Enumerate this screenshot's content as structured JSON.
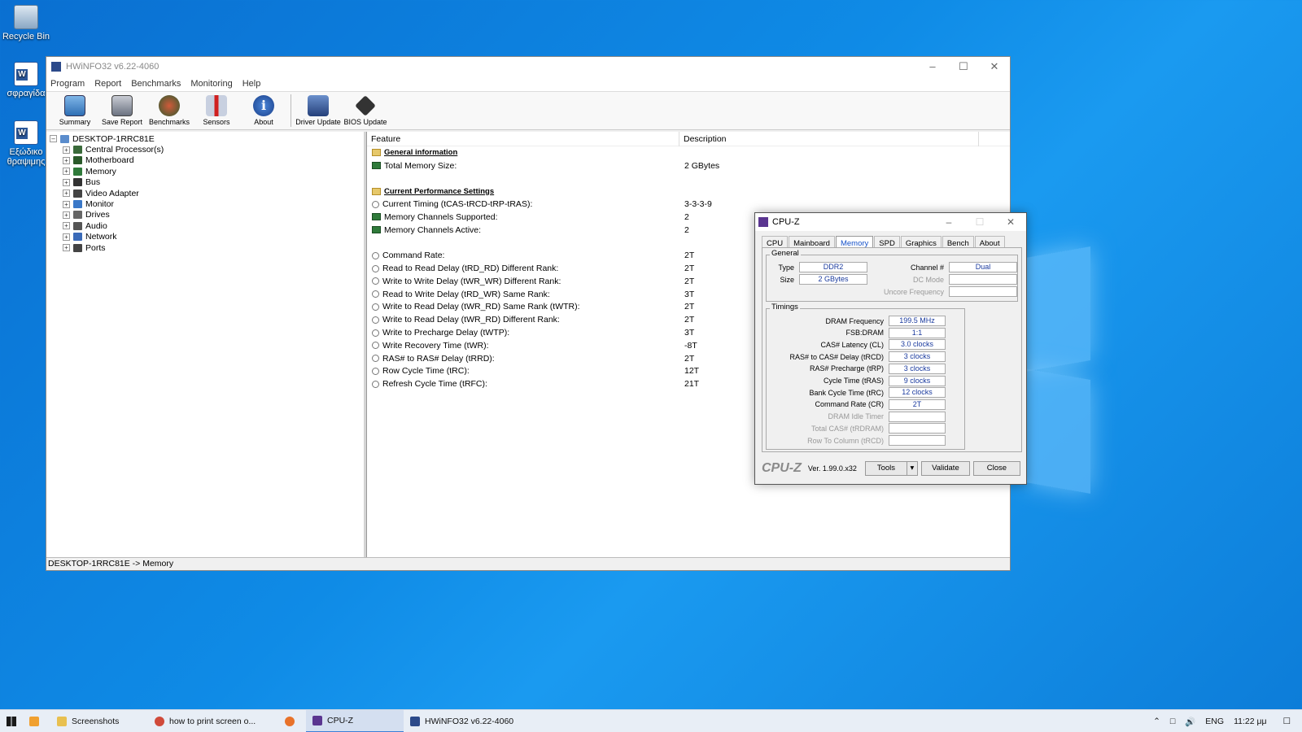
{
  "desktop": {
    "icons": [
      {
        "label": "Recycle Bin"
      },
      {
        "label": "σφραγίδα"
      },
      {
        "label": "Εξώδικο θραψιμης"
      }
    ]
  },
  "hwinfo": {
    "title": "HWiNFO32 v6.22-4060",
    "menu": [
      "Program",
      "Report",
      "Benchmarks",
      "Monitoring",
      "Help"
    ],
    "toolbar": [
      {
        "label": "Summary",
        "icon": "monitor-icon"
      },
      {
        "label": "Save Report",
        "icon": "save-icon"
      },
      {
        "label": "Benchmarks",
        "icon": "gauge-icon"
      },
      {
        "label": "Sensors",
        "icon": "thermometer-icon"
      },
      {
        "label": "About",
        "icon": "info-icon"
      },
      {
        "label": "Driver Update",
        "icon": "driver-update-icon"
      },
      {
        "label": "BIOS Update",
        "icon": "chip-icon"
      }
    ],
    "tree": {
      "root": "DESKTOP-1RRC81E",
      "items": [
        "Central Processor(s)",
        "Motherboard",
        "Memory",
        "Bus",
        "Video Adapter",
        "Monitor",
        "Drives",
        "Audio",
        "Network",
        "Ports"
      ]
    },
    "columns": {
      "feature": "Feature",
      "description": "Description"
    },
    "rows": [
      {
        "kind": "section",
        "name": "General information",
        "value": ""
      },
      {
        "kind": "mem",
        "name": "Total Memory Size:",
        "value": "2 GBytes"
      },
      {
        "kind": "blank",
        "name": "",
        "value": ""
      },
      {
        "kind": "section",
        "name": "Current Performance Settings",
        "value": ""
      },
      {
        "kind": "clock",
        "name": "Current Timing (tCAS-tRCD-tRP-tRAS):",
        "value": "3-3-3-9"
      },
      {
        "kind": "mem",
        "name": "Memory Channels Supported:",
        "value": "2"
      },
      {
        "kind": "mem",
        "name": "Memory Channels Active:",
        "value": "2"
      },
      {
        "kind": "blank",
        "name": "",
        "value": ""
      },
      {
        "kind": "clock",
        "name": "Command Rate:",
        "value": "2T"
      },
      {
        "kind": "clock",
        "name": "Read to Read Delay (tRD_RD) Different Rank:",
        "value": "2T"
      },
      {
        "kind": "clock",
        "name": "Write to Write Delay (tWR_WR) Different Rank:",
        "value": "2T"
      },
      {
        "kind": "clock",
        "name": "Read to Write Delay (tRD_WR) Same Rank:",
        "value": "3T"
      },
      {
        "kind": "clock",
        "name": "Write to Read Delay (tWR_RD) Same Rank (tWTR):",
        "value": "2T"
      },
      {
        "kind": "clock",
        "name": "Write to Read Delay (tWR_RD) Different Rank:",
        "value": "2T"
      },
      {
        "kind": "clock",
        "name": "Write to Precharge Delay (tWTP):",
        "value": "3T"
      },
      {
        "kind": "clock",
        "name": "Write Recovery Time (tWR):",
        "value": "-8T"
      },
      {
        "kind": "clock",
        "name": "RAS# to RAS# Delay (tRRD):",
        "value": "2T"
      },
      {
        "kind": "clock",
        "name": "Row Cycle Time (tRC):",
        "value": "12T"
      },
      {
        "kind": "clock",
        "name": "Refresh Cycle Time (tRFC):",
        "value": "21T"
      }
    ],
    "status": "DESKTOP-1RRC81E -> Memory"
  },
  "cpuz": {
    "title": "CPU-Z",
    "tabs": [
      "CPU",
      "Mainboard",
      "Memory",
      "SPD",
      "Graphics",
      "Bench",
      "About"
    ],
    "active_tab": "Memory",
    "general_label": "General",
    "general": {
      "type_label": "Type",
      "type": "DDR2",
      "size_label": "Size",
      "size": "2 GBytes",
      "channel_label": "Channel #",
      "channel": "Dual",
      "dcmode_label": "DC Mode",
      "dcmode": "",
      "uncore_label": "Uncore Frequency",
      "uncore": ""
    },
    "timings_label": "Timings",
    "timings": [
      {
        "label": "DRAM Frequency",
        "value": "199.5 MHz",
        "dim": false
      },
      {
        "label": "FSB:DRAM",
        "value": "1:1",
        "dim": false
      },
      {
        "label": "CAS# Latency (CL)",
        "value": "3.0 clocks",
        "dim": false
      },
      {
        "label": "RAS# to CAS# Delay (tRCD)",
        "value": "3 clocks",
        "dim": false
      },
      {
        "label": "RAS# Precharge (tRP)",
        "value": "3 clocks",
        "dim": false
      },
      {
        "label": "Cycle Time (tRAS)",
        "value": "9 clocks",
        "dim": false
      },
      {
        "label": "Bank Cycle Time (tRC)",
        "value": "12 clocks",
        "dim": false
      },
      {
        "label": "Command Rate (CR)",
        "value": "2T",
        "dim": false
      },
      {
        "label": "DRAM Idle Timer",
        "value": "",
        "dim": true
      },
      {
        "label": "Total CAS# (tRDRAM)",
        "value": "",
        "dim": true
      },
      {
        "label": "Row To Column (tRCD)",
        "value": "",
        "dim": true
      }
    ],
    "footer": {
      "logo": "CPU-Z",
      "version": "Ver. 1.99.0.x32",
      "tools": "Tools",
      "validate": "Validate",
      "close": "Close"
    }
  },
  "taskbar": {
    "items": [
      {
        "label": "Screenshots",
        "icon": "folder-icon",
        "active": false
      },
      {
        "label": "how to print screen o...",
        "icon": "chrome-icon",
        "active": false
      },
      {
        "label": "",
        "icon": "firefox-icon",
        "active": false
      },
      {
        "label": "CPU-Z",
        "icon": "cpuz-icon",
        "active": true
      },
      {
        "label": "HWiNFO32 v6.22-4060",
        "icon": "hwinfo-icon",
        "active": false
      }
    ],
    "lang": "ENG",
    "time": "11:22 μμ"
  },
  "colors": {
    "desktop": "#0f8be6",
    "accent": "#1450c8",
    "cpuz_value": "#1a3a9e"
  }
}
